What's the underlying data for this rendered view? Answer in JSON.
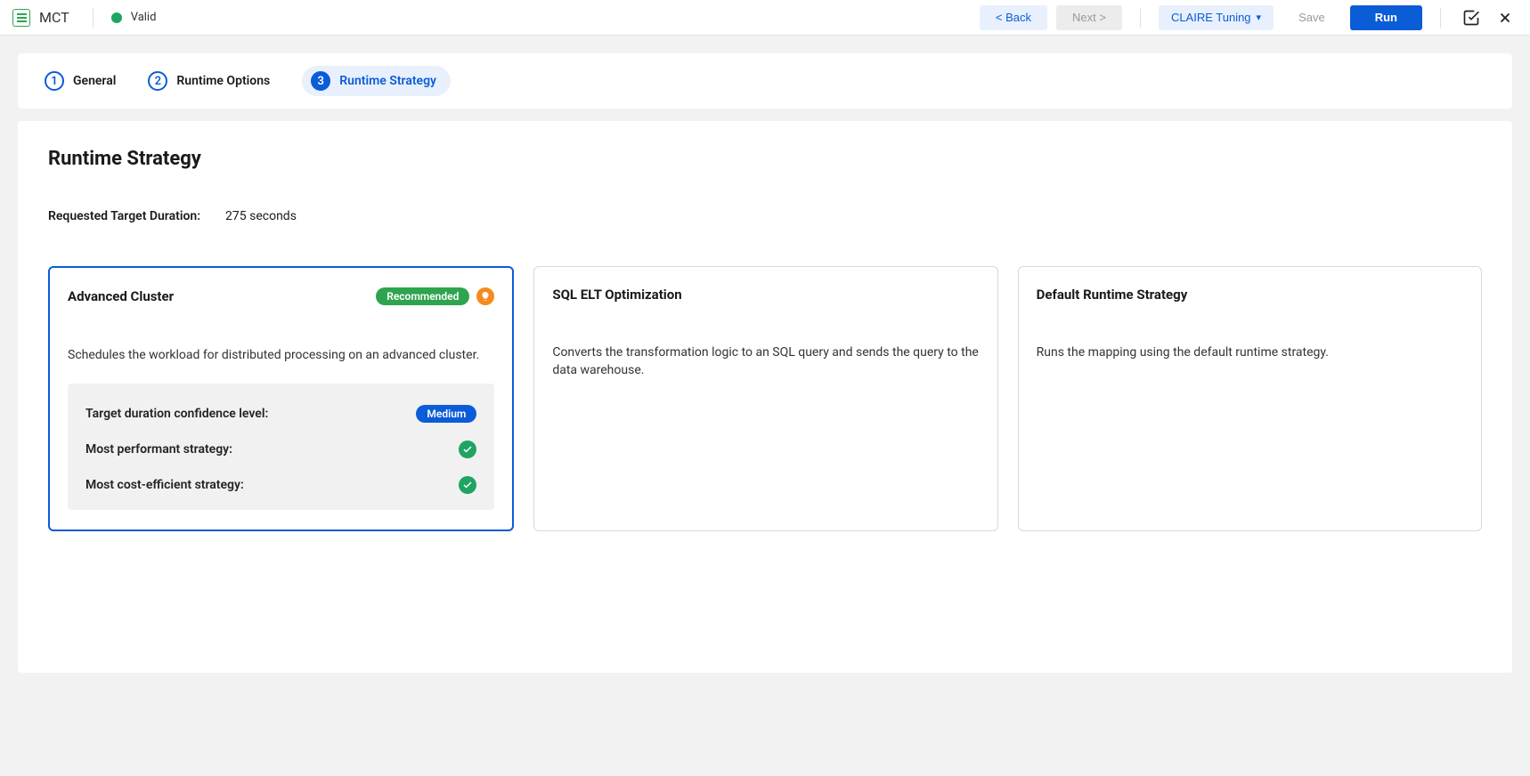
{
  "topbar": {
    "app_name": "MCT",
    "status": "Valid",
    "back_label": "< Back",
    "next_label": "Next >",
    "dropdown_label": "CLAIRE Tuning",
    "save_label": "Save",
    "run_label": "Run"
  },
  "steps": [
    {
      "num": "1",
      "label": "General"
    },
    {
      "num": "2",
      "label": "Runtime Options"
    },
    {
      "num": "3",
      "label": "Runtime Strategy"
    }
  ],
  "section": {
    "title": "Runtime Strategy",
    "duration_label": "Requested Target Duration:",
    "duration_value": "275 seconds"
  },
  "cards": [
    {
      "title": "Advanced Cluster",
      "recommended": "Recommended",
      "description": "Schedules the workload for distributed processing on an advanced cluster.",
      "metrics": {
        "confidence_label": "Target duration confidence level:",
        "confidence_value": "Medium",
        "performant_label": "Most performant strategy:",
        "cost_label": "Most cost-efficient strategy:"
      }
    },
    {
      "title": "SQL ELT Optimization",
      "description": "Converts the transformation logic to an SQL query and sends the query to the data warehouse."
    },
    {
      "title": "Default Runtime Strategy",
      "description": "Runs the mapping using the default runtime strategy."
    }
  ]
}
